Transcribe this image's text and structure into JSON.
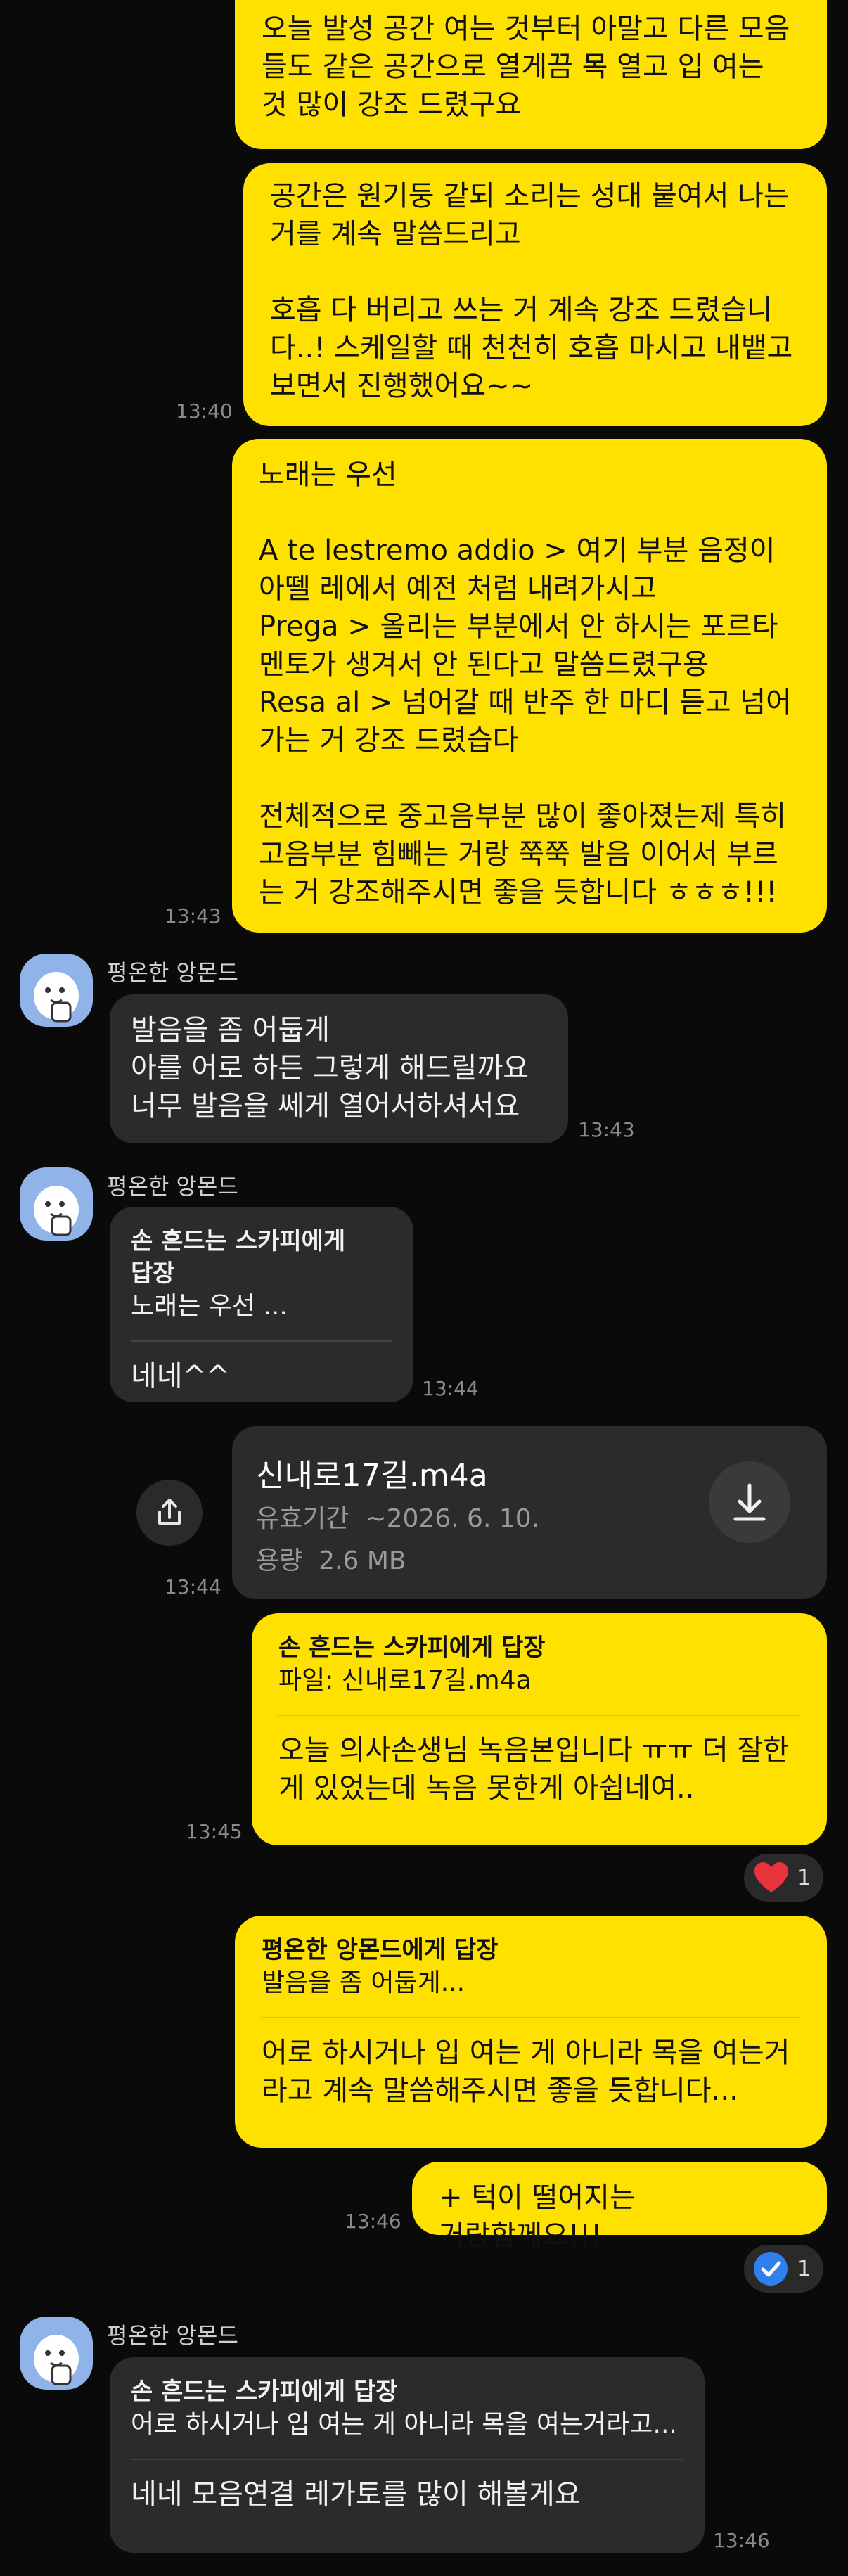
{
  "messages": {
    "m1": {
      "text": "오늘 발성 공간 여는 것부터 아말고 다른 모음\n들도 같은 공간으로 열게끔 목 열고 입 여는\n것 많이 강조 드렸구요"
    },
    "m2": {
      "text": "공간은 원기둥 같되 소리는 성대 붙여서 나는\n거를 계속 말씀드리고\n\n호흡 다 버리고 쓰는 거 계속 강조 드렸습니\n다..! 스케일할 때 천천히 호흡 마시고 내뱉고\n보면서 진행했어요~~",
      "time": "13:40"
    },
    "m3": {
      "text": "노래는 우선\n\nA te lestremo addio > 여기 부분 음정이\n아뗄 레에서 예전 처럼 내려가시고\nPrega > 올리는 부분에서 안 하시는 포르타\n멘토가 생겨서 안 된다고 말씀드렸구용\nResa al > 넘어갈 때 반주 한 마디 듣고 넘어\n가는 거 강조 드렸습다\n\n전체적으로 중고음부분 많이 좋아졌는제 특히\n고음부분 힘빼는 거랑 쭉쭉 발음 이어서 부르\n는 거 강조해주시면 좋을 듯합니다 ㅎㅎㅎ!!!",
      "time": "13:43"
    },
    "m4": {
      "sender": "평온한 앙몬드",
      "text": "발음을 좀 어둡게\n아를 어로 하든 그렇게 해드릴까요\n너무 발음을 쎄게 열어서하셔서요",
      "time": "13:43"
    },
    "m5": {
      "sender": "평온한 앙몬드",
      "reply_title": "손 흔드는 스카피에게 답장",
      "reply_quote": "노래는 우선 ...",
      "text": "네네^^",
      "time": "13:44"
    },
    "m6": {
      "filename": "신내로17길.m4a",
      "expiry_label": "유효기간",
      "expiry_value": "~2026. 6. 10.",
      "size_label": "용량",
      "size_value": "2.6 MB",
      "time": "13:44"
    },
    "m7": {
      "reply_title": "손 흔드는 스카피에게 답장",
      "reply_quote": "파일: 신내로17길.m4a",
      "text": "오늘 의사손생님 녹음본입니다 ㅠㅠ 더 잘한\n게 있었는데 녹음 못한게 아쉽네여..",
      "time": "13:45",
      "reaction_count": "1"
    },
    "m8": {
      "reply_title": "평온한 앙몬드에게 답장",
      "reply_quote": "발음을 좀 어둡게...",
      "text": "어로 하시거나 입 여는 게 아니라 목을 여는거\n라고 계속 말씀해주시면 좋을 듯합니다..."
    },
    "m9": {
      "text": "+ 턱이 떨어지는 거랑함께요!!!",
      "time": "13:46",
      "reaction_count": "1"
    },
    "m10": {
      "sender": "평온한 앙몬드",
      "reply_title": "손 흔드는 스카피에게 답장",
      "reply_quote": "어로 하시거나 입 여는 게 아니라 목을 여는거라고...",
      "text": "네네 모음연결 레가토를  많이 해볼게요",
      "time": "13:46"
    }
  },
  "colors": {
    "my_bubble": "#ffe100",
    "their_bubble": "#2b2b2b",
    "background": "#0a0a0a",
    "heart": "#e8323c",
    "check": "#2f80ed"
  },
  "icons": {
    "share": "share-icon",
    "download": "download-icon",
    "heart": "heart-icon",
    "check": "check-icon",
    "avatar": "bunny-avatar"
  }
}
